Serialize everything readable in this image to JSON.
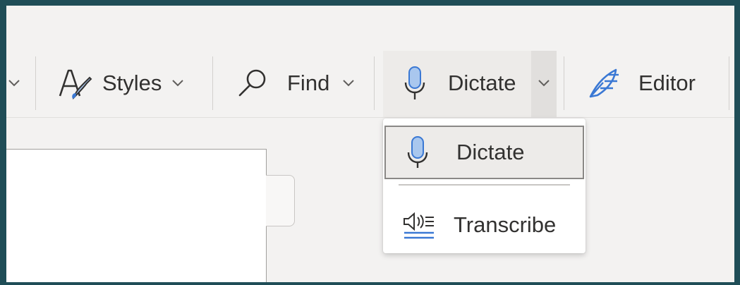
{
  "toolbar": {
    "styles_label": "Styles",
    "find_label": "Find",
    "dictate_label": "Dictate",
    "editor_label": "Editor"
  },
  "dropdown": {
    "items": [
      {
        "label": "Dictate",
        "icon": "microphone-icon",
        "selected": true
      },
      {
        "label": "Transcribe",
        "icon": "transcribe-icon",
        "selected": false
      }
    ]
  },
  "colors": {
    "accent_blue": "#3a78d4",
    "mic_fill": "#a9c7ee",
    "ribbon_bg": "#f3f2f1",
    "frame_border": "#1f4d57"
  }
}
